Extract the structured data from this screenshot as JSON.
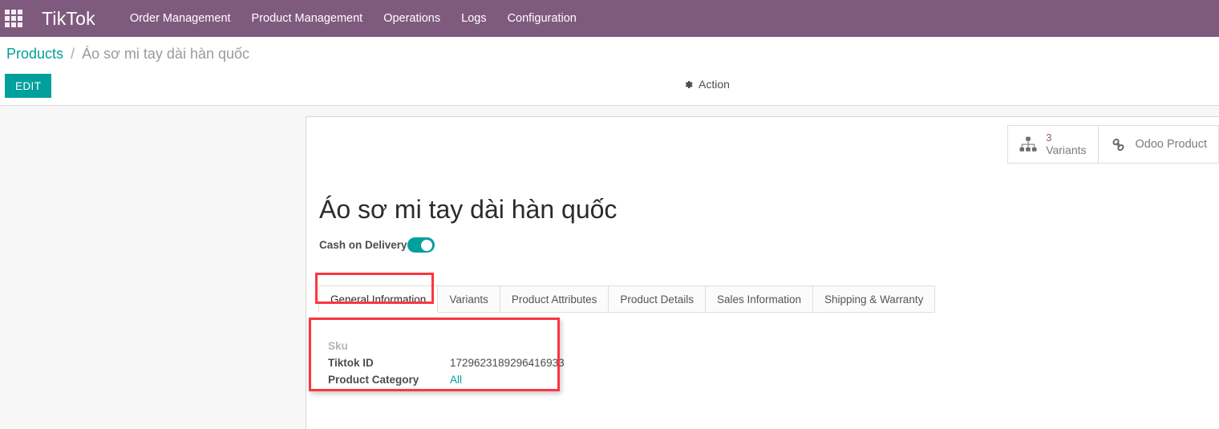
{
  "navbar": {
    "apps_icon": "apps-grid-icon",
    "brand": "TikTok",
    "menu": [
      {
        "label": "Order Management"
      },
      {
        "label": "Product Management"
      },
      {
        "label": "Operations"
      },
      {
        "label": "Logs"
      },
      {
        "label": "Configuration"
      }
    ]
  },
  "breadcrumb": {
    "root": "Products",
    "separator": "/",
    "current": "Áo sơ mi tay dài hàn quốc"
  },
  "control_panel": {
    "edit_label": "EDIT",
    "action_label": "Action",
    "action_icon": "gear-icon"
  },
  "stat_buttons": [
    {
      "icon": "sitemap-icon",
      "value": "3",
      "label": "Variants"
    },
    {
      "icon": "chain-link-icon",
      "label": "Odoo Product"
    }
  ],
  "record": {
    "title": "Áo sơ mi tay dài hàn quốc",
    "cash_on_delivery": {
      "label": "Cash on Delivery",
      "value": "on"
    }
  },
  "tabs": [
    {
      "label": "General Information",
      "active": true
    },
    {
      "label": "Variants",
      "active": false
    },
    {
      "label": "Product Attributes",
      "active": false
    },
    {
      "label": "Product Details",
      "active": false
    },
    {
      "label": "Sales Information",
      "active": false
    },
    {
      "label": "Shipping & Warranty",
      "active": false
    }
  ],
  "general_information": {
    "fields": [
      {
        "label": "Sku",
        "value": "",
        "muted_label": true,
        "is_link": false
      },
      {
        "label": "Tiktok ID",
        "value": "1729623189296416933",
        "muted_label": false,
        "is_link": false
      },
      {
        "label": "Product Category",
        "value": "All",
        "muted_label": false,
        "is_link": true
      }
    ]
  },
  "colors": {
    "navbar": "#7f5a7f",
    "accent_teal": "#00a09d",
    "annotation_red": "#fb3640",
    "page_bg": "#f7f7f7",
    "stat_value": "#8f5f7f"
  }
}
